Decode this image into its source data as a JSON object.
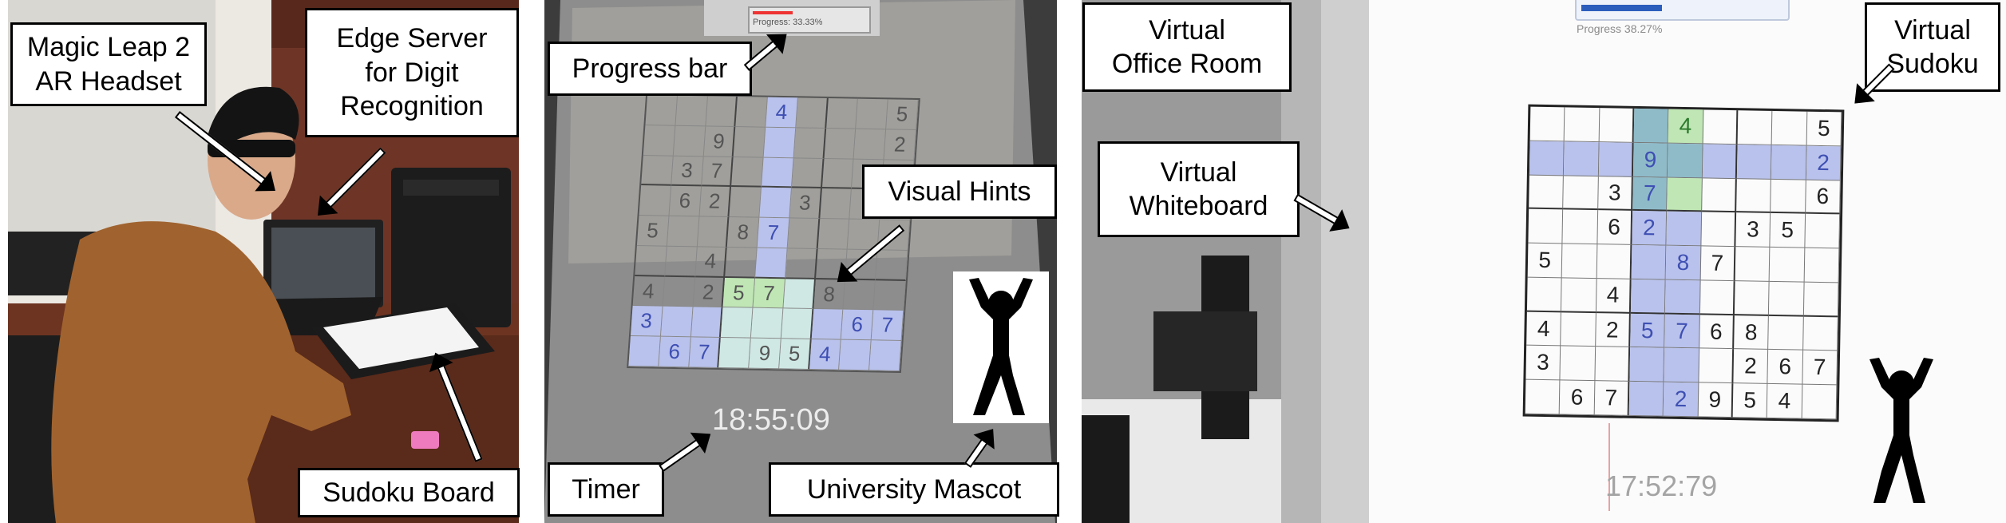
{
  "labels": {
    "headset": "Magic Leap 2\nAR Headset",
    "edge_server": "Edge Server\nfor Digit\nRecognition",
    "sudoku_board": "Sudoku Board",
    "progress_bar": "Progress bar",
    "visual_hints": "Visual Hints",
    "timer": "Timer",
    "mascot": "University Mascot",
    "office_room": "Virtual\nOffice Room",
    "whiteboard": "Virtual\nWhiteboard",
    "virtual_sudoku": "Virtual\nSudoku"
  },
  "panel2": {
    "progress_text": "Progress: 33.33%",
    "timer": "18:55:09",
    "grid": [
      [
        "",
        "",
        "",
        "",
        "4",
        "",
        "",
        "",
        "5"
      ],
      [
        "",
        "",
        "9",
        "",
        "",
        "",
        "",
        "",
        "2"
      ],
      [
        "",
        "3",
        "7",
        "",
        "",
        "",
        "",
        "",
        ""
      ],
      [
        "",
        "6",
        "2",
        "",
        "",
        "3",
        "",
        "",
        ""
      ],
      [
        "5",
        "",
        "",
        "8",
        "7",
        "",
        "",
        "",
        ""
      ],
      [
        "",
        "",
        "4",
        "",
        "",
        "",
        "",
        "",
        ""
      ],
      [
        "4",
        "",
        "2",
        "5",
        "7",
        "",
        "8",
        "",
        ""
      ],
      [
        "3",
        "",
        "",
        "",
        "",
        "",
        "",
        "6",
        "7"
      ],
      [
        "",
        "6",
        "7",
        "",
        "9",
        "5",
        "4",
        "",
        ""
      ]
    ]
  },
  "panel4": {
    "progress_text": "Progress 38.27%",
    "progress_value": 0.3827,
    "timer": "17:52:79",
    "grid": [
      [
        "",
        "",
        "",
        "",
        "4",
        "",
        "",
        "",
        "5"
      ],
      [
        "",
        "",
        "",
        "9",
        "",
        "",
        "",
        "",
        "2"
      ],
      [
        "",
        "",
        "3",
        "7",
        "",
        "",
        "",
        "",
        "6"
      ],
      [
        "",
        "",
        "6",
        "2",
        "",
        "",
        "3",
        "5",
        ""
      ],
      [
        "5",
        "",
        "",
        "",
        "8",
        "7",
        "",
        "",
        ""
      ],
      [
        "",
        "",
        "4",
        "",
        "",
        "",
        "",
        "",
        ""
      ],
      [
        "4",
        "",
        "2",
        "5",
        "7",
        "6",
        "8",
        "",
        ""
      ],
      [
        "3",
        "",
        "",
        "",
        "",
        "",
        "2",
        "6",
        "7"
      ],
      [
        "",
        "6",
        "7",
        "",
        "2",
        "9",
        "5",
        "4",
        ""
      ]
    ]
  },
  "colors": {
    "hint_blue": "#b9c2ec",
    "hint_green": "#bfe6b4",
    "digit_blue": "#3e4fb3"
  }
}
